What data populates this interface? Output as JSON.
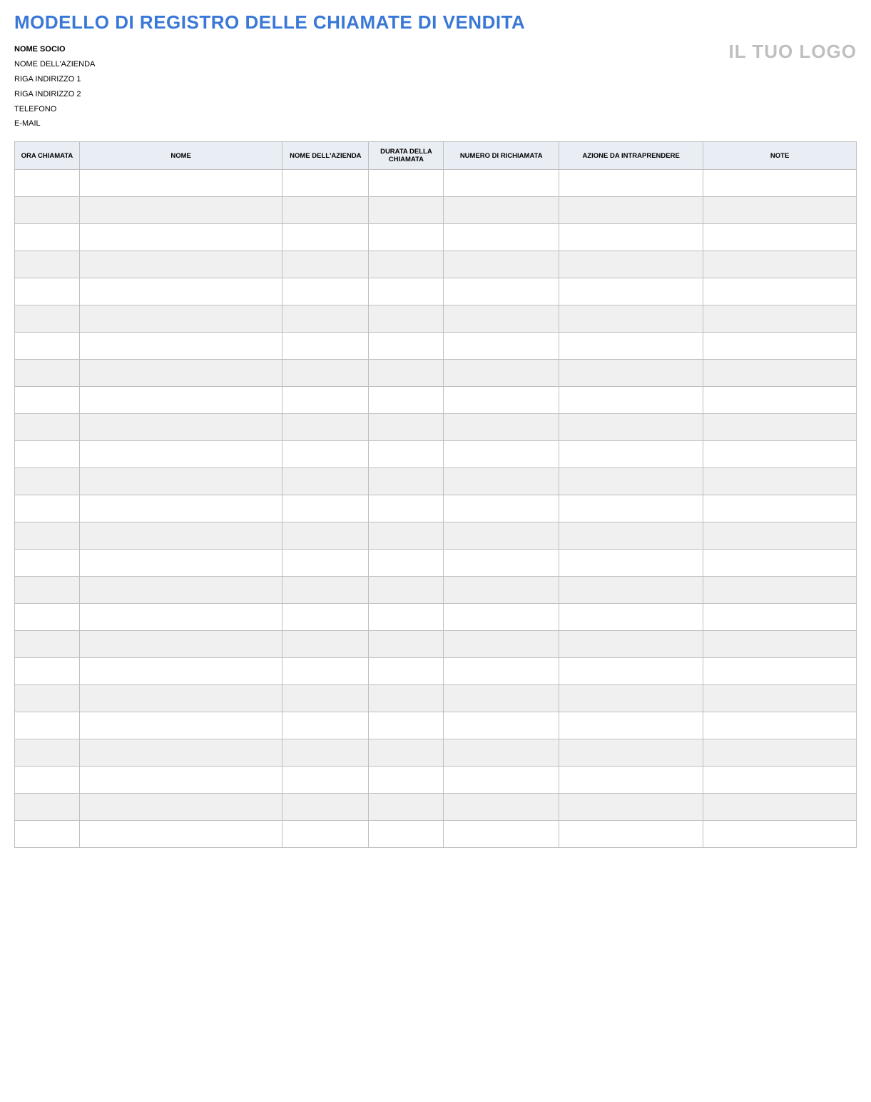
{
  "title": "MODELLO DI REGISTRO DELLE CHIAMATE DI VENDITA",
  "logo_text": "IL TUO LOGO",
  "info": {
    "partner_name": "NOME SOCIO",
    "company_name": "NOME DELL'AZIENDA",
    "address_line_1": "RIGA INDIRIZZO 1",
    "address_line_2": "RIGA INDIRIZZO 2",
    "phone": "TELEFONO",
    "email": "E-MAIL"
  },
  "columns": [
    "ORA CHIAMATA",
    "NOME",
    "NOME DELL'AZIENDA",
    "DURATA DELLA CHIAMATA",
    "NUMERO DI RICHIAMATA",
    "AZIONE DA INTRAPRENDERE",
    "NOTE"
  ],
  "row_count": 25
}
